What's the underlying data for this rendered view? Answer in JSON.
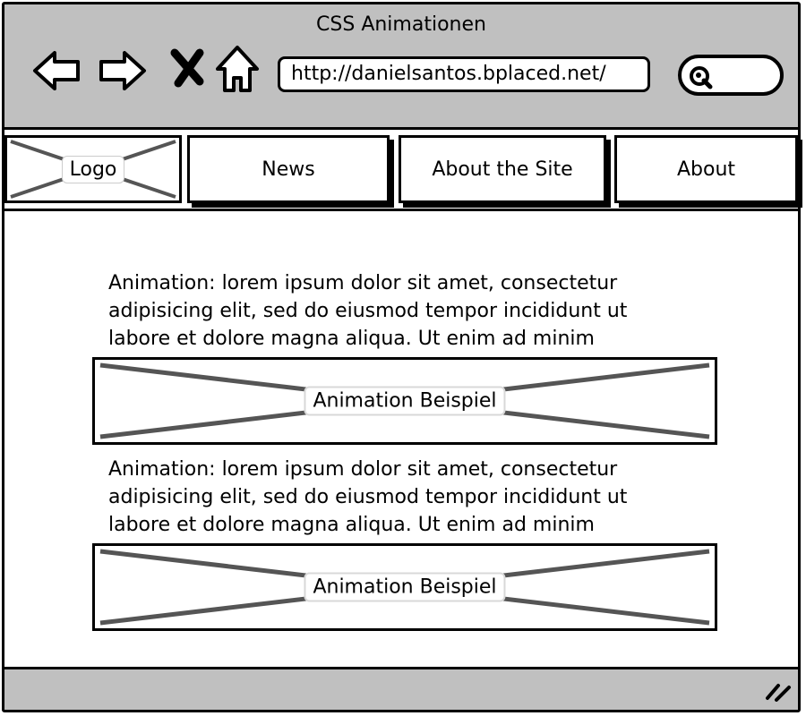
{
  "browser": {
    "window_title": "CSS Animationen",
    "url": "http://danielsantos.bplaced.net/",
    "nav_icons": [
      "back-arrow-icon",
      "forward-arrow-icon",
      "stop-x-icon",
      "home-icon"
    ],
    "search_icon": "magnifier-icon"
  },
  "menu": {
    "logo_label": "Logo",
    "items": [
      {
        "label": "News"
      },
      {
        "label": "About the Site"
      },
      {
        "label": "About"
      }
    ]
  },
  "content": {
    "sections": [
      {
        "lines": [
          "Animation: lorem ipsum dolor sit amet, consectetur",
          "adipisicing elit, sed do eiusmod tempor incididunt ut",
          "labore et dolore magna aliqua. Ut enim ad minim"
        ],
        "placeholder_label": "Animation Beispiel"
      },
      {
        "lines": [
          "Animation: lorem ipsum dolor sit amet, consectetur",
          "adipisicing elit, sed do eiusmod tempor incididunt ut",
          "labore et dolore magna aliqua. Ut enim ad minim"
        ],
        "placeholder_label": "Animation Beispiel"
      }
    ]
  },
  "colors": {
    "chrome": "#c0c0c0",
    "border": "#000000",
    "cross": "#555555"
  }
}
